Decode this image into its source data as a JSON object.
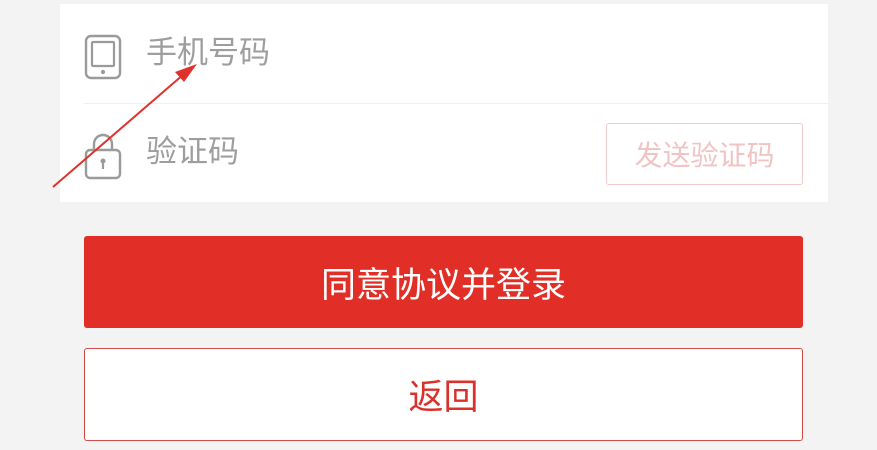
{
  "login_form": {
    "phone_placeholder": "手机号码",
    "code_placeholder": "验证码",
    "send_code_label": "发送验证码"
  },
  "actions": {
    "agree_login_label": "同意协议并登录",
    "back_label": "返回"
  },
  "icons": {
    "phone": "phone-icon",
    "lock": "lock-icon",
    "annotation": "arrow-icon"
  },
  "colors": {
    "primary": "#e12f27",
    "secondary_text": "#d8322b",
    "annotation": "#e0322b"
  }
}
